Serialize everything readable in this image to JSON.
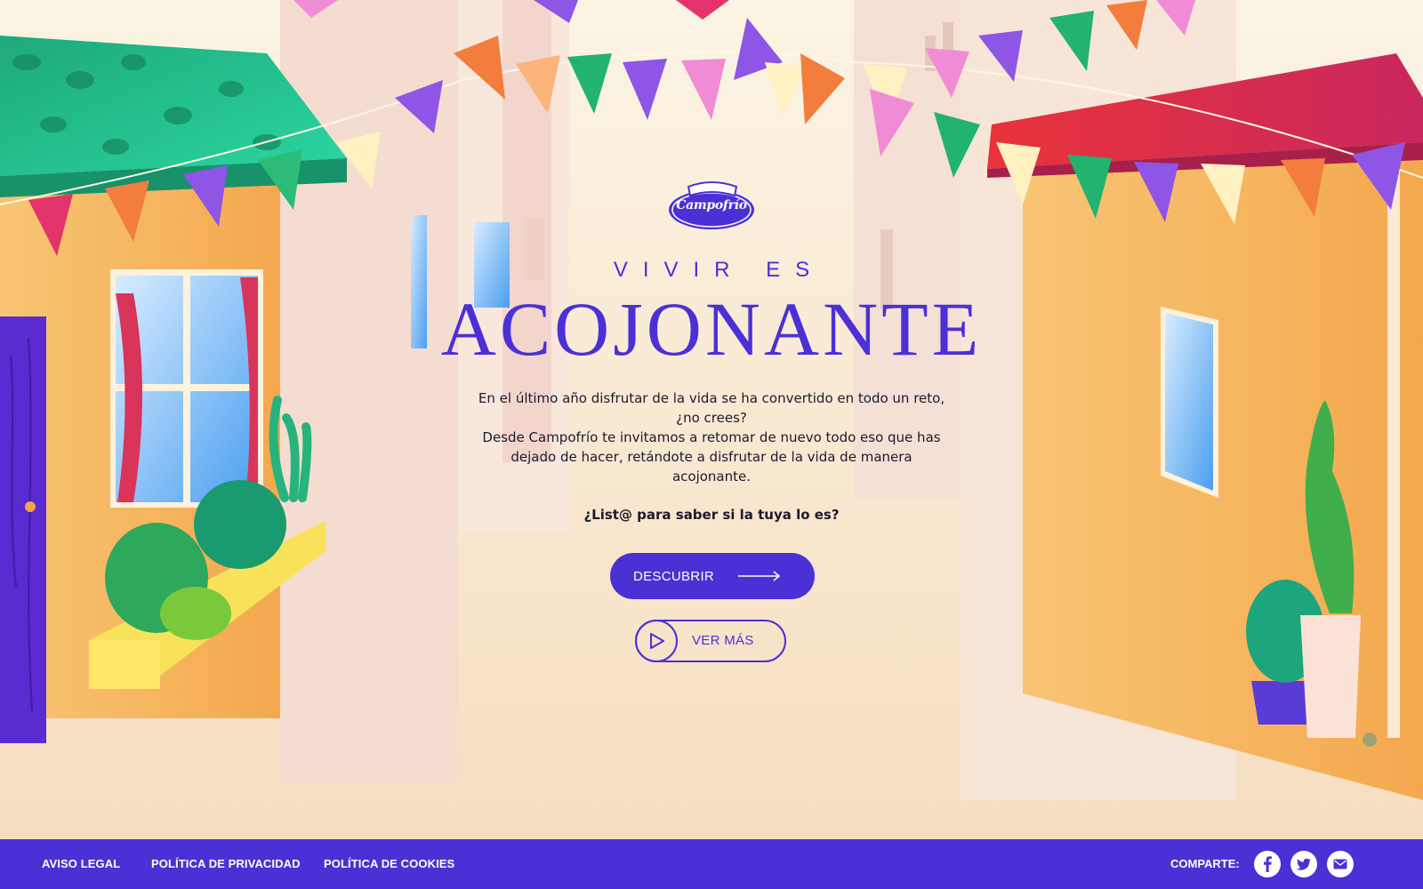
{
  "brand": {
    "logo_text": "Campofrío"
  },
  "hero": {
    "kicker": "VIVIR ES",
    "headline": "ACOJONANTE",
    "intro_line1": "En el último año disfrutar de la vida se ha convertido en todo un reto, ¿no crees?",
    "intro_line2": "Desde Campofrío te invitamos a retomar de nuevo todo eso que has dejado de hacer, retándote a disfrutar de la vida de manera acojonante.",
    "question": "¿List@ para saber si la tuya lo es?",
    "primary_button": "DESCUBRIR",
    "secondary_button": "VER MÁS"
  },
  "footer": {
    "links": [
      "AVISO LEGAL",
      "POLÍTICA DE PRIVACIDAD",
      "POLÍTICA DE COOKIES"
    ],
    "share_label": "COMPARTE:",
    "social": [
      "facebook-icon",
      "twitter-icon",
      "mail-icon"
    ]
  },
  "colors": {
    "accent": "#4b30d6",
    "background": "#fbf1de",
    "text": "#1c1a2c",
    "footer_text": "#ffffff"
  }
}
